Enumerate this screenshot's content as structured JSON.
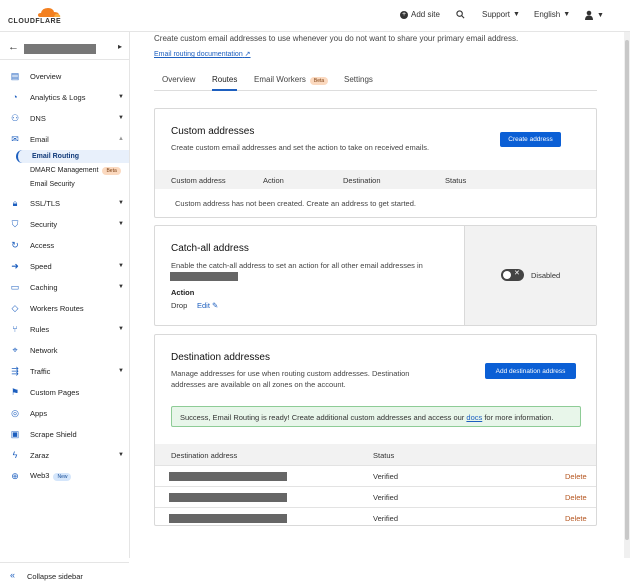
{
  "brand": {
    "name": "CLOUDFLARE",
    "color": "#f38020"
  },
  "topbar": {
    "add_site": "Add site",
    "support": "Support",
    "language": "English"
  },
  "sidebar": {
    "items": [
      {
        "label": "Overview",
        "icon": "document-icon"
      },
      {
        "label": "Analytics & Logs",
        "icon": "chart-icon",
        "dropdown": true
      },
      {
        "label": "DNS",
        "icon": "dns-icon",
        "dropdown": true
      },
      {
        "label": "Email",
        "icon": "mail-icon",
        "expanded": true
      },
      {
        "label": "SSL/TLS",
        "icon": "lock-icon",
        "dropdown": true
      },
      {
        "label": "Security",
        "icon": "shield-icon",
        "dropdown": true
      },
      {
        "label": "Access",
        "icon": "access-icon"
      },
      {
        "label": "Speed",
        "icon": "speed-icon",
        "dropdown": true
      },
      {
        "label": "Caching",
        "icon": "caching-icon",
        "dropdown": true
      },
      {
        "label": "Workers Routes",
        "icon": "workers-icon"
      },
      {
        "label": "Rules",
        "icon": "rules-icon",
        "dropdown": true
      },
      {
        "label": "Network",
        "icon": "network-icon"
      },
      {
        "label": "Traffic",
        "icon": "traffic-icon",
        "dropdown": true
      },
      {
        "label": "Custom Pages",
        "icon": "pages-icon"
      },
      {
        "label": "Apps",
        "icon": "apps-icon"
      },
      {
        "label": "Scrape Shield",
        "icon": "scrape-icon"
      },
      {
        "label": "Zaraz",
        "icon": "zaraz-icon",
        "dropdown": true
      },
      {
        "label": "Web3",
        "icon": "web3-icon",
        "badge": "New"
      }
    ],
    "email_sub": [
      {
        "label": "Email Routing",
        "active": true
      },
      {
        "label": "DMARC Management",
        "badge": "Beta"
      },
      {
        "label": "Email Security"
      }
    ],
    "collapse": "Collapse sidebar"
  },
  "main": {
    "intro": "Create custom email addresses to use whenever you do not want to share your primary email address.",
    "doc_link": "Email routing documentation",
    "tabs": [
      {
        "label": "Overview"
      },
      {
        "label": "Routes",
        "active": true
      },
      {
        "label": "Email Workers",
        "badge": "Beta"
      },
      {
        "label": "Settings"
      }
    ]
  },
  "custom": {
    "title": "Custom addresses",
    "desc": "Create custom email addresses and set the action to take on received emails.",
    "button": "Create address",
    "columns": [
      "Custom address",
      "Action",
      "Destination",
      "Status"
    ],
    "empty": "Custom address has not been created. Create an address to get started."
  },
  "catchall": {
    "title": "Catch-all address",
    "desc": "Enable the catch-all address to set an action for all other email addresses in",
    "action_label": "Action",
    "action_value": "Drop",
    "edit": "Edit",
    "toggle_label": "Disabled"
  },
  "destination": {
    "title": "Destination addresses",
    "desc1": "Manage addresses for use when routing custom addresses. Destination",
    "desc2": "addresses are available on all zones on the account.",
    "button": "Add destination address",
    "success_pre": "Success, Email Routing is ready! Create additional custom addresses and access our",
    "success_link": "docs",
    "success_post": "for more information.",
    "columns": [
      "Destination address",
      "Status"
    ],
    "rows": [
      {
        "status": "Verified",
        "action": "Delete"
      },
      {
        "status": "Verified",
        "action": "Delete"
      },
      {
        "status": "Verified",
        "action": "Delete"
      }
    ]
  }
}
